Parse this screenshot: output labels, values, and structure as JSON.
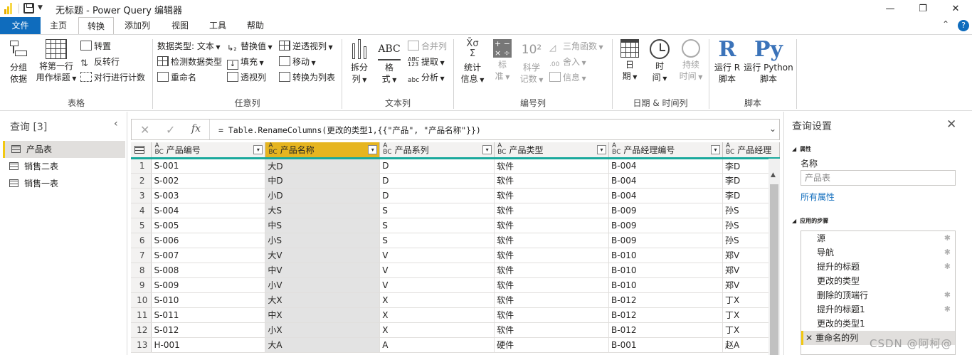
{
  "window": {
    "title": "无标题 - Power Query 编辑器",
    "minimize": "—",
    "restore": "❐",
    "close": "✕"
  },
  "tabs": [
    {
      "label": "文件"
    },
    {
      "label": "主页"
    },
    {
      "label": "转换"
    },
    {
      "label": "添加列"
    },
    {
      "label": "视图"
    },
    {
      "label": "工具"
    },
    {
      "label": "帮助"
    }
  ],
  "help_icon": "?",
  "ribbon": {
    "table": {
      "label": "表格",
      "group_by_1": "分组",
      "group_by_2": "依据",
      "first_row_1": "将第一行",
      "first_row_2": "用作标题",
      "transpose": "转置",
      "reverse_rows": "反转行",
      "count_rows": "对行进行计数"
    },
    "any_col": {
      "label": "任意列",
      "data_type": "数据类型: 文本",
      "detect_type": "检测数据类型",
      "rename": "重命名",
      "replace": "替换值",
      "fill": "填充",
      "pivot": "透视列",
      "unpivot": "逆透视列",
      "move": "移动",
      "to_list": "转换为列表"
    },
    "text_col": {
      "label": "文本列",
      "split_1": "拆分",
      "split_2": "列",
      "format_1": "格",
      "format_2": "式",
      "merge": "合并列",
      "extract": "提取",
      "parse": "分析"
    },
    "number_col": {
      "label": "编号列",
      "stats_1": "统计",
      "stats_2": "信息",
      "std_1": "标",
      "std_2": "准",
      "sci_1": "科学",
      "sci_2": "记数",
      "trig": "三角函数",
      "round": "舍入",
      "info": "信息"
    },
    "datetime": {
      "label": "日期 & 时间列",
      "date_1": "日",
      "date_2": "期",
      "time_1": "时",
      "time_2": "间",
      "duration_1": "持续",
      "duration_2": "时间"
    },
    "scripts": {
      "label": "脚本",
      "r_1": "运行 R",
      "r_2": "脚本",
      "py_1": "运行 Python",
      "py_2": "脚本",
      "r_glyph": "R",
      "py_glyph": "Py"
    }
  },
  "queries": {
    "title": "查询 [3]",
    "items": [
      {
        "label": "产品表"
      },
      {
        "label": "销售二表"
      },
      {
        "label": "销售一表"
      }
    ]
  },
  "formula": {
    "cancel": "✕",
    "commit": "✓",
    "fx": "fx",
    "text": "= Table.RenameColumns(更改的类型1,{{\"产品\", \"产品名称\"}})"
  },
  "grid": {
    "columns": [
      "产品编号",
      "产品名称",
      "产品系列",
      "产品类型",
      "产品经理编号",
      "产品经理"
    ],
    "rows": [
      [
        "1",
        "S-001",
        "大D",
        "D",
        "软件",
        "B-004",
        "李D"
      ],
      [
        "2",
        "S-002",
        "中D",
        "D",
        "软件",
        "B-004",
        "李D"
      ],
      [
        "3",
        "S-003",
        "小D",
        "D",
        "软件",
        "B-004",
        "李D"
      ],
      [
        "4",
        "S-004",
        "大S",
        "S",
        "软件",
        "B-009",
        "孙S"
      ],
      [
        "5",
        "S-005",
        "中S",
        "S",
        "软件",
        "B-009",
        "孙S"
      ],
      [
        "6",
        "S-006",
        "小S",
        "S",
        "软件",
        "B-009",
        "孙S"
      ],
      [
        "7",
        "S-007",
        "大V",
        "V",
        "软件",
        "B-010",
        "郑V"
      ],
      [
        "8",
        "S-008",
        "中V",
        "V",
        "软件",
        "B-010",
        "郑V"
      ],
      [
        "9",
        "S-009",
        "小V",
        "V",
        "软件",
        "B-010",
        "郑V"
      ],
      [
        "10",
        "S-010",
        "大X",
        "X",
        "软件",
        "B-012",
        "丁X"
      ],
      [
        "11",
        "S-011",
        "中X",
        "X",
        "软件",
        "B-012",
        "丁X"
      ],
      [
        "12",
        "S-012",
        "小X",
        "X",
        "软件",
        "B-012",
        "丁X"
      ],
      [
        "13",
        "H-001",
        "大A",
        "A",
        "硬件",
        "B-001",
        "赵A"
      ]
    ]
  },
  "settings": {
    "title": "查询设置",
    "props_header": "属性",
    "name_label": "名称",
    "name_value": "产品表",
    "all_props": "所有属性",
    "steps_header": "应用的步骤",
    "steps": [
      {
        "label": "源"
      },
      {
        "label": "导航"
      },
      {
        "label": "提升的标题"
      },
      {
        "label": "更改的类型"
      },
      {
        "label": "删除的顶端行"
      },
      {
        "label": "提升的标题1"
      },
      {
        "label": "更改的类型1"
      },
      {
        "label": "重命名的列"
      }
    ]
  },
  "watermark": "CSDN @阿柯@"
}
